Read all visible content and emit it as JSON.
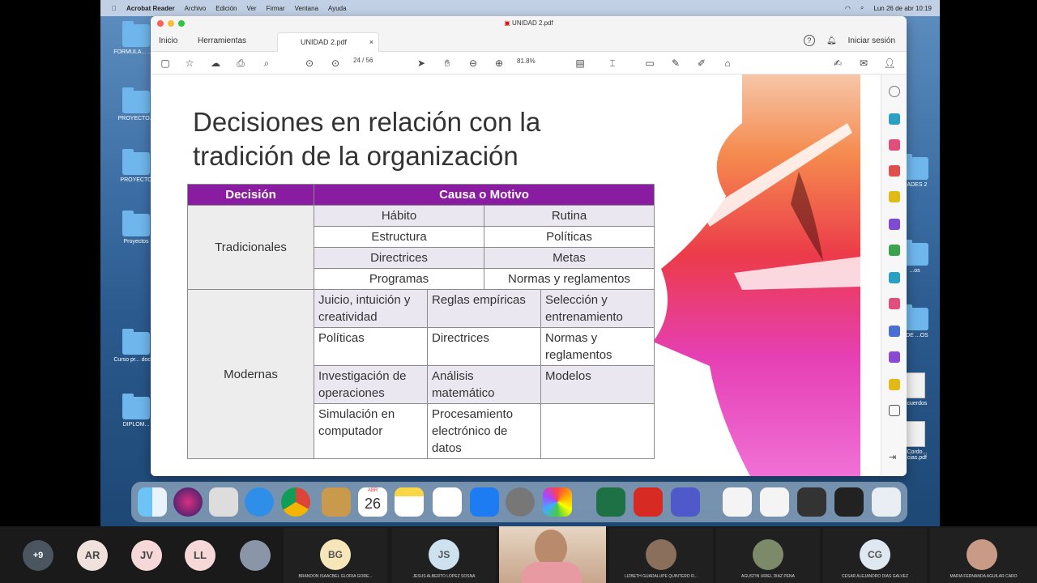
{
  "menubar": {
    "apple": "",
    "items": [
      "Acrobat Reader",
      "Archivo",
      "Edición",
      "Ver",
      "Firmar",
      "Ventana",
      "Ayuda"
    ],
    "clock": "Lun 26 de abr  10:19"
  },
  "desktop_icons": [
    "FORMULA... ... ...",
    "PROYECTO...",
    "PROYECTO",
    "Proyectos",
    "Curso pr... docu...",
    "DIPLOM...",
    "...ADES 2",
    "...os",
    "...DE ...OS",
    "...cuerdos",
    "...Cordo... ...cias.pdf"
  ],
  "window": {
    "title": "UNIDAD 2.pdf",
    "tabs": {
      "home": "Inicio",
      "tools": "Herramientas",
      "doc": "UNIDAD 2.pdf",
      "close": "×"
    },
    "signin": "Iniciar sesión",
    "help": "?",
    "page_current": "24",
    "page_sep": "/",
    "page_total": "56",
    "zoom": "81.8%"
  },
  "slide": {
    "title_line1": "Decisiones en relación con la",
    "title_line2": "tradición de la organización",
    "table": {
      "header": [
        "Decisión",
        "Causa o Motivo"
      ],
      "tradicionales": {
        "label": "Tradicionales",
        "rows": [
          [
            "Hábito",
            "Rutina"
          ],
          [
            "Estructura",
            "Políticas"
          ],
          [
            "Directrices",
            "Metas"
          ],
          [
            "Programas",
            "Normas y reglamentos"
          ]
        ]
      },
      "modernas": {
        "label": "Modernas",
        "rows": [
          [
            "Juicio, intuición y creatividad",
            "Reglas empíricas",
            "Selección y entrenamiento"
          ],
          [
            "Políticas",
            "Directrices",
            "Normas y reglamentos"
          ],
          [
            "Investigación de operaciones",
            "Análisis matemático",
            "Modelos"
          ],
          [
            "Simulación en computador",
            "Procesamiento electrónico de datos",
            ""
          ]
        ]
      }
    }
  },
  "dock": {
    "calendar_month": "ABR",
    "calendar_day": "26"
  },
  "participants": {
    "more": "+9",
    "initials": [
      "AR",
      "JV",
      "LL"
    ],
    "tiles": [
      {
        "initials": "BG",
        "name": "BRANDON ISAACBEL GLORIA GORE..."
      },
      {
        "initials": "JS",
        "name": "JESUS ALBERTO LOPEZ SOSNA"
      },
      {
        "initials": "",
        "name": ""
      },
      {
        "initials": "",
        "name": "LIZBETH GUADALUPE QUINTERO R..."
      },
      {
        "initials": "",
        "name": "AGUSTIN URIEL DIAZ PENA"
      },
      {
        "initials": "CG",
        "name": "CESAR ALEJANDRO DIAS GALVEZ"
      },
      {
        "initials": "",
        "name": "MARIA FERNANDA AGUILAR CARO"
      }
    ]
  }
}
